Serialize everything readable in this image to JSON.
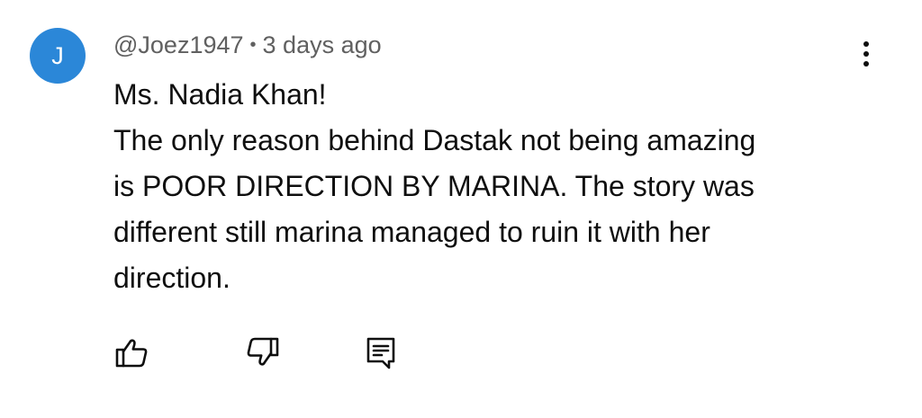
{
  "comment": {
    "avatar_letter": "J",
    "avatar_color": "#2b87d8",
    "author": "@Joez1947",
    "separator": "•",
    "timestamp": "3 days ago",
    "lines": [
      "Ms. Nadia Khan!",
      "The only reason behind Dastak not being amazing",
      "is POOR DIRECTION BY MARINA. The story was",
      "different still marina managed to ruin it with her",
      "direction."
    ]
  },
  "icons": {
    "more": "more-vert-icon",
    "like": "thumbs-up-icon",
    "dislike": "thumbs-down-icon",
    "reply": "reply-comment-icon"
  }
}
